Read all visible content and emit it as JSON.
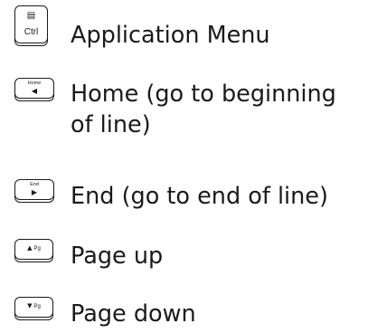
{
  "legend": {
    "items": [
      {
        "key_glyph": "▤",
        "key_label": "Ctrl",
        "key_glyph_icon": "menu-icon",
        "description": "Application Menu"
      },
      {
        "key_label": "Home",
        "key_glyph": "◀",
        "key_glyph_icon": "arrow-left-icon",
        "description": "Home (go to beginning of line)"
      },
      {
        "key_label": "End",
        "key_glyph": "▶",
        "key_glyph_icon": "arrow-right-icon",
        "description": "End (go to end of line)"
      },
      {
        "key_glyph": "▲",
        "key_label": "Pg",
        "key_glyph_icon": "arrow-up-icon",
        "description": "Page up"
      },
      {
        "key_glyph": "▼",
        "key_label": "Pg",
        "key_glyph_icon": "arrow-down-icon",
        "description": "Page down"
      }
    ]
  }
}
